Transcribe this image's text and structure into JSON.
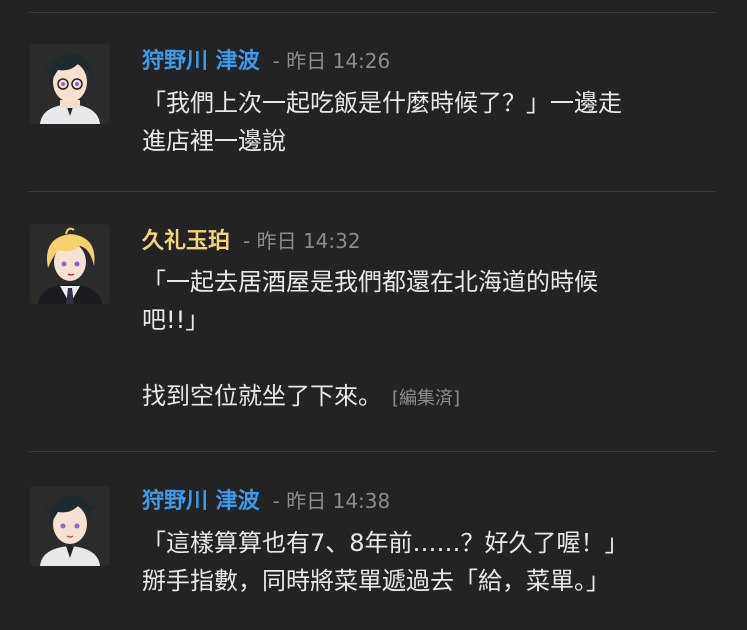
{
  "messages": [
    {
      "author": "狩野川 津波",
      "author_color": "#3d9be9",
      "separator": "-",
      "timestamp": "昨日 14:26",
      "lines": [
        "「我們上次一起吃飯是什麼時候了？」一邊走",
        "進店裡一邊說"
      ],
      "avatar_icon": "dark-haired-character-avatar"
    },
    {
      "author": "久礼玉珀",
      "author_color": "#f0d57a",
      "separator": "-",
      "timestamp": "昨日 14:32",
      "lines": [
        "「一起去居酒屋是我們都還在北海道的時候",
        "吧!!」"
      ],
      "extra_line": "找到空位就坐了下來。",
      "edited_label": "[編集済]",
      "avatar_icon": "blond-character-avatar"
    },
    {
      "author": "狩野川 津波",
      "author_color": "#3d9be9",
      "separator": "-",
      "timestamp": "昨日 14:38",
      "lines": [
        "「這樣算算也有7、8年前……？好久了喔！」",
        "掰手指數，同時將菜單遞過去「給，菜單。」"
      ],
      "avatar_icon": "dark-haired-character-avatar"
    }
  ]
}
